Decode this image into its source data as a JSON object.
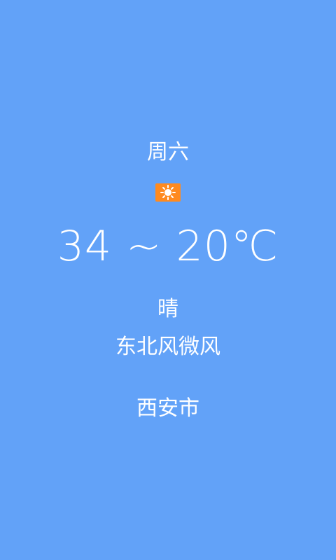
{
  "weather": {
    "day": "周六",
    "icon": "sun-icon",
    "icon_color": "#ff8a1f",
    "temperature": "34 ~ 20℃",
    "condition": "晴",
    "wind": "东北风微风",
    "city": "西安市"
  },
  "theme": {
    "background": "#62a2f8",
    "text": "#ffffff"
  }
}
